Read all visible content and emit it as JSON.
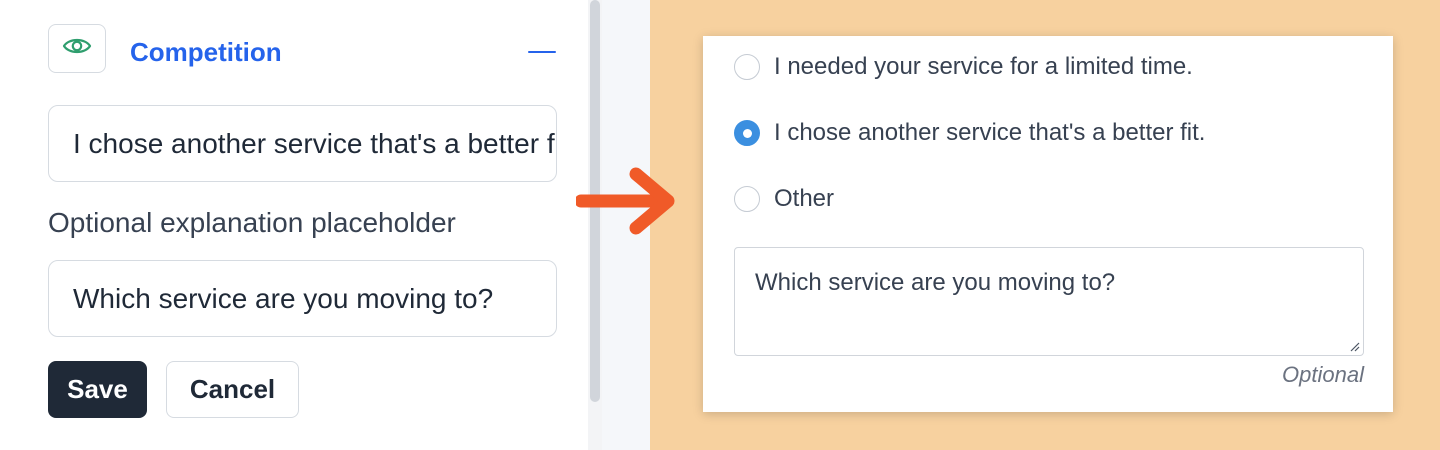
{
  "editor": {
    "section_title": "Competition",
    "reason_value": "I chose another service that's a better fit.",
    "placeholder_label": "Optional explanation placeholder",
    "placeholder_value": "Which service are you moving to?",
    "save_label": "Save",
    "cancel_label": "Cancel",
    "icons": {
      "visibility": "eye-icon",
      "collapse": "minus-icon"
    }
  },
  "arrow": {
    "icon": "arrow-right-icon",
    "color": "#f05a28"
  },
  "preview": {
    "options": [
      {
        "label": "I needed your service for a limited time.",
        "selected": false
      },
      {
        "label": "I chose another service that's a better fit.",
        "selected": true
      },
      {
        "label": "Other",
        "selected": false
      }
    ],
    "textarea_placeholder": "Which service are you moving to?",
    "optional_label": "Optional"
  },
  "colors": {
    "accent_blue": "#2563eb",
    "radio_selected": "#3b8fe0",
    "preview_background": "#f7d19f",
    "save_button": "#1f2937",
    "eye_icon": "#2f9e6e"
  }
}
